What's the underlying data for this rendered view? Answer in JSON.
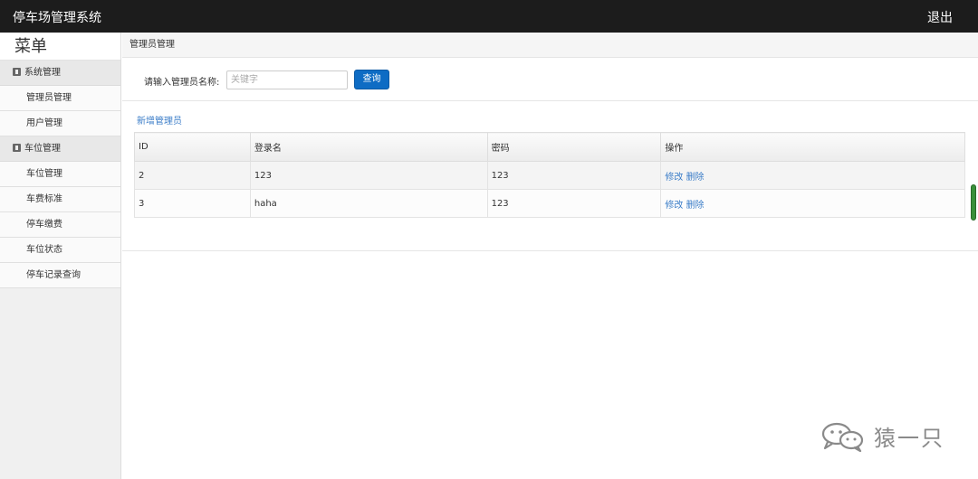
{
  "header": {
    "title": "停车场管理系统",
    "logout_label": "退出"
  },
  "sidebar": {
    "menu_title": "菜单",
    "groups": [
      {
        "label": "系统管理",
        "items": [
          {
            "label": "管理员管理"
          },
          {
            "label": "用户管理"
          }
        ]
      },
      {
        "label": "车位管理",
        "items": [
          {
            "label": "车位管理"
          },
          {
            "label": "车费标准"
          },
          {
            "label": "停车缴费"
          },
          {
            "label": "车位状态"
          },
          {
            "label": "停车记录查询"
          }
        ]
      }
    ]
  },
  "main": {
    "breadcrumb": "管理员管理",
    "search": {
      "label": "请输入管理员名称:",
      "placeholder": "关键字",
      "value": "",
      "button_label": "查询"
    },
    "add_link": "新增管理员",
    "table": {
      "columns": [
        "ID",
        "登录名",
        "密码",
        "操作"
      ],
      "rows": [
        {
          "id": "2",
          "login": "123",
          "password": "123",
          "edit": "修改",
          "delete": "删除"
        },
        {
          "id": "3",
          "login": "haha",
          "password": "123",
          "edit": "修改",
          "delete": "删除"
        }
      ]
    }
  },
  "watermark": {
    "text": "猿一只",
    "icon": "wechat-icon"
  },
  "colors": {
    "topbar": "#1c1c1c",
    "accent": "#0e6cc4",
    "link": "#3b7dc8"
  }
}
